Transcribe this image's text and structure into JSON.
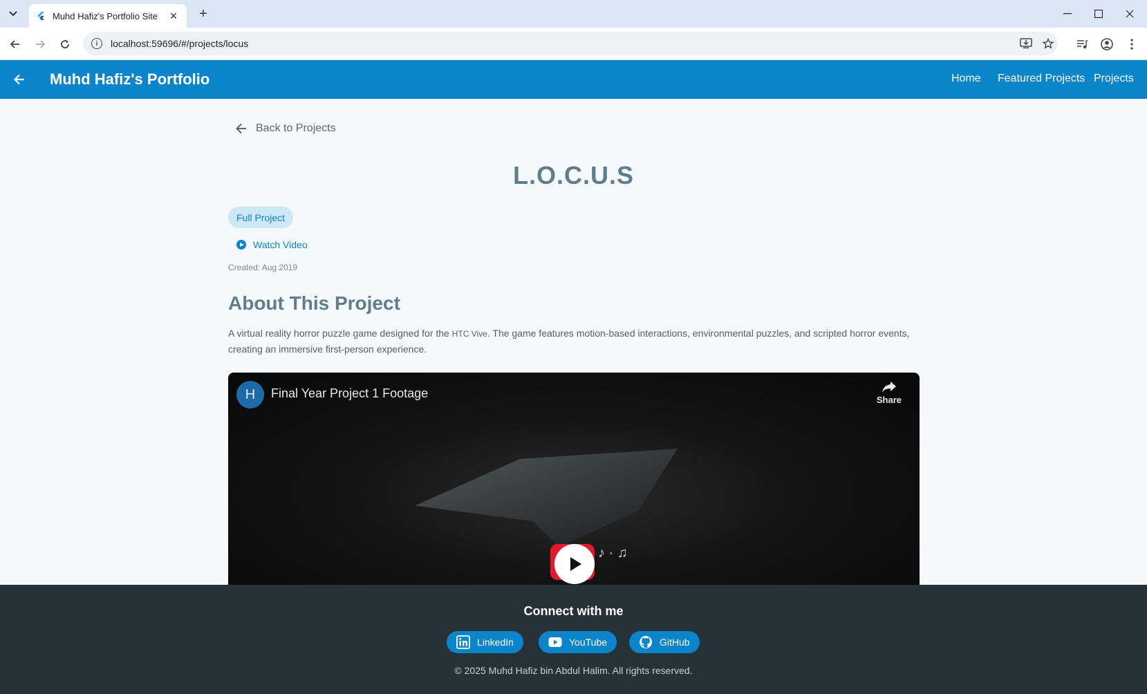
{
  "browser": {
    "tab_title": "Muhd Hafiz's Portfolio Site",
    "url": "localhost:59696/#/projects/locus"
  },
  "appbar": {
    "title": "Muhd Hafiz's Portfolio",
    "nav": [
      "Home",
      "Featured Projects",
      "Projects"
    ]
  },
  "project": {
    "back_label": "Back to Projects",
    "title": "L.O.C.U.S",
    "chip": "Full Project",
    "watch_video": "Watch Video",
    "created": "Created: Aug 2019",
    "about_heading": "About This Project",
    "desc_before": "A virtual reality horror puzzle game designed for the ",
    "desc_mono": "HTC Vive",
    "desc_after": ". The game features motion-based interactions, environmental puzzles, and scripted horror events, creating an immersive first-person experience."
  },
  "video": {
    "avatar_letter": "H",
    "title": "Final Year Project 1 Footage",
    "share_label": "Share"
  },
  "footer": {
    "title": "Connect with me",
    "links": [
      "LinkedIn",
      "YouTube",
      "GitHub"
    ],
    "copyright": "© 2025 Muhd Hafiz bin Abdul Halim. All rights reserved."
  },
  "colors": {
    "primary": "#0a85cc",
    "title_grey": "#607d8b",
    "footer_bg": "#263238"
  }
}
